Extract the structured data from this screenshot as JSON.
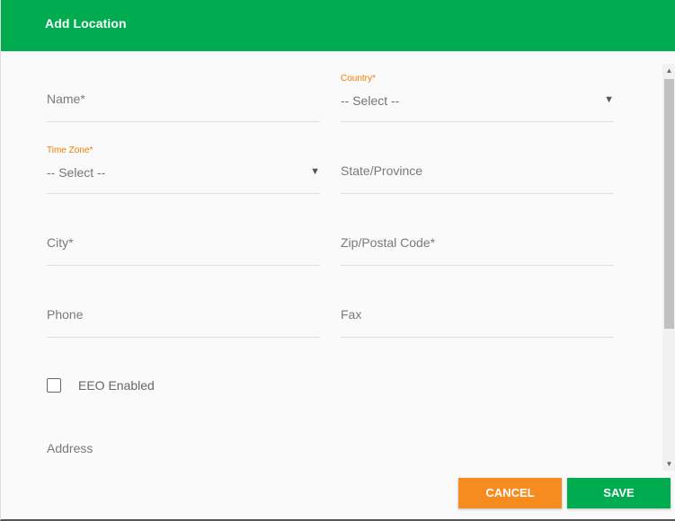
{
  "dialog": {
    "title": "Add Location"
  },
  "form": {
    "name": {
      "placeholder": "Name*"
    },
    "country": {
      "label": "Country*",
      "value": "-- Select --"
    },
    "time_zone": {
      "label": "Time Zone*",
      "value": "-- Select --"
    },
    "state": {
      "placeholder": "State/Province"
    },
    "city": {
      "placeholder": "City*"
    },
    "zip": {
      "placeholder": "Zip/Postal Code*"
    },
    "phone": {
      "placeholder": "Phone"
    },
    "fax": {
      "placeholder": "Fax"
    },
    "eeo": {
      "label": "EEO Enabled",
      "checked": false
    },
    "address": {
      "placeholder": "Address"
    }
  },
  "icons": {
    "caret": "▼",
    "scroll_up": "▲",
    "scroll_down": "▼"
  },
  "buttons": {
    "cancel": "CANCEL",
    "save": "SAVE"
  },
  "colors": {
    "header": "#00ac4f",
    "cancel": "#f68b1f",
    "save": "#00ac4f",
    "label_accent": "#f57c00"
  }
}
